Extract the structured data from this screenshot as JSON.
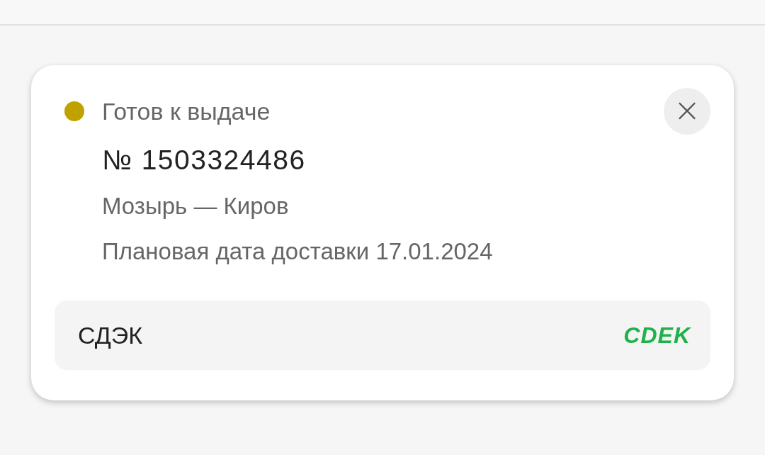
{
  "status": {
    "label": "Готов к выдаче",
    "color": "#bfa100"
  },
  "close_button": {
    "label": "×"
  },
  "order": {
    "number": "№ 1503324486",
    "route": "Мозырь — Киров",
    "delivery_date": "Плановая дата доставки 17.01.2024"
  },
  "carrier": {
    "name": "СДЭК",
    "logo": "CDEK"
  }
}
